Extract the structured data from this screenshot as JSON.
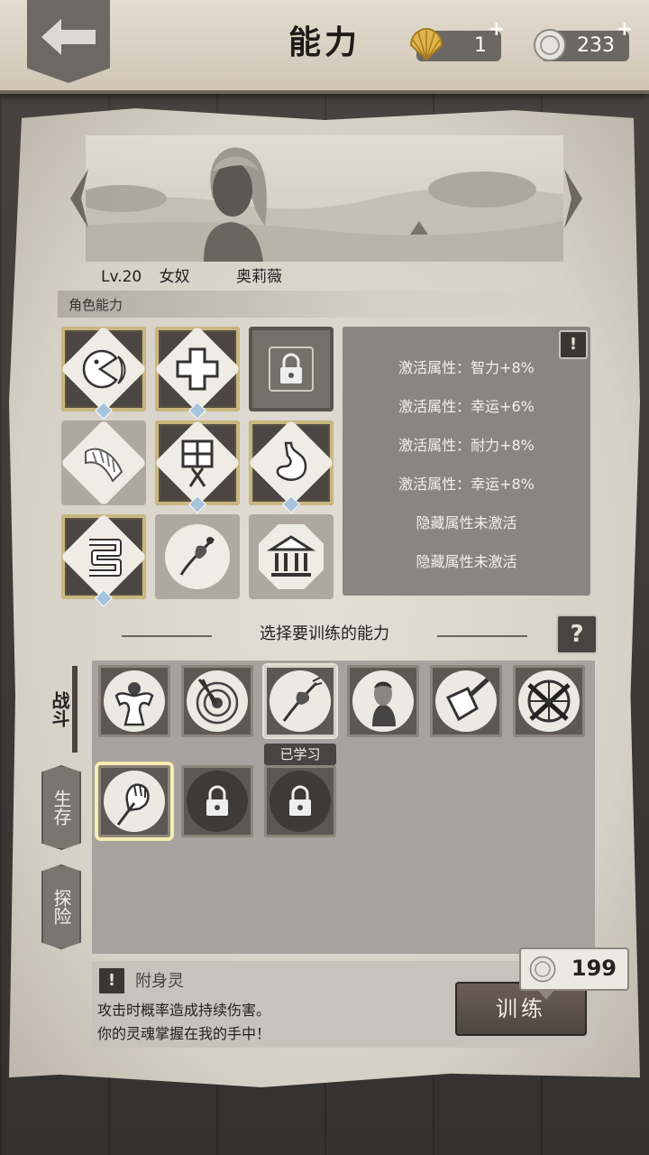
{
  "header": {
    "title": "能力",
    "shell_count": "1",
    "coin_count": "233",
    "plus": "+"
  },
  "character": {
    "level": "Lv.20",
    "role": "女奴",
    "name": "奥莉薇"
  },
  "section": {
    "abilities_title": "角色能力"
  },
  "abilities": {
    "grid": [
      {
        "icon": "pacman-moon-icon",
        "state": "active"
      },
      {
        "icon": "cross-icon",
        "state": "active"
      },
      {
        "icon": "lock-icon",
        "state": "locked"
      },
      {
        "icon": "bandaged-arm-icon",
        "state": "inactive"
      },
      {
        "icon": "window-figure-icon",
        "state": "active"
      },
      {
        "icon": "stomach-icon",
        "state": "active"
      },
      {
        "icon": "intestine-icon",
        "state": "active"
      },
      {
        "icon": "voodoo-needle-icon",
        "state": "inactive"
      },
      {
        "icon": "temple-icon",
        "state": "inactive"
      }
    ],
    "attributes": [
      "激活属性：智力+8%",
      "激活属性：幸运+6%",
      "激活属性：耐力+8%",
      "激活属性：幸运+8%",
      "隐藏属性未激活",
      "隐藏属性未激活"
    ],
    "info_mark": "!"
  },
  "training": {
    "title": "选择要训练的能力",
    "help_mark": "?",
    "tabs": [
      "战斗",
      "生存",
      "探险"
    ],
    "learned_label": "已学习",
    "skills_row1": [
      "strongman-icon",
      "target-arrow-icon",
      "voodoo-doll-icon",
      "warrior-portrait-icon",
      "cleaver-icon",
      "crossed-rifles-icon"
    ],
    "skills_row2": [
      "hand-needle-icon",
      "locked-skill-icon",
      "locked-skill-icon"
    ]
  },
  "description": {
    "mark": "!",
    "title": "附身灵",
    "line1": "攻击时概率造成持续伤害。",
    "line2": "你的灵魂掌握在我的手中！"
  },
  "train_button": {
    "label": "训练",
    "cost": "199"
  }
}
